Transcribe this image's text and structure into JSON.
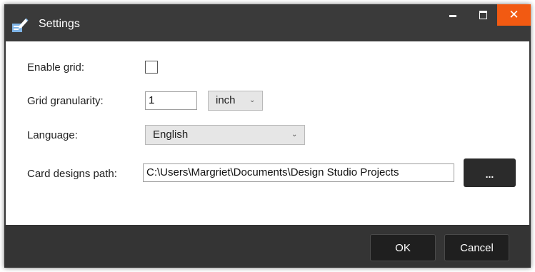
{
  "window": {
    "title": "Settings",
    "app_icon": "settings-app-icon",
    "controls": {
      "minimize_icon": "minimize-icon",
      "maximize_icon": "maximize-icon",
      "close_icon": "close-icon",
      "close_glyph": "✕"
    }
  },
  "form": {
    "enable_grid": {
      "label": "Enable grid:",
      "checked": false
    },
    "grid_granularity": {
      "label": "Grid granularity:",
      "value": "1",
      "unit": "inch"
    },
    "language": {
      "label": "Language:",
      "value": "English"
    },
    "card_designs_path": {
      "label": "Card designs path:",
      "value": "C:\\Users\\Margriet\\Documents\\Design Studio Projects",
      "browse_label": "..."
    }
  },
  "footer": {
    "ok_label": "OK",
    "cancel_label": "Cancel"
  },
  "colors": {
    "close_button": "#f25a12",
    "title_bar": "#3a3a3a",
    "footer": "#343434"
  }
}
